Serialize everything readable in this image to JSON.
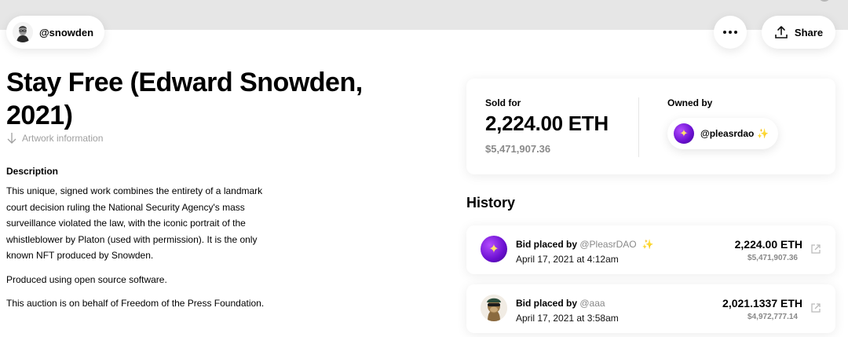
{
  "creator": {
    "handle": "@snowden",
    "avatar_icon": "snowden-portrait-icon"
  },
  "header": {
    "more_icon": "ellipsis-icon",
    "share_label": "Share",
    "share_icon": "upload-icon"
  },
  "artwork": {
    "title": "Stay Free (Edward Snowden, 2021)",
    "info_link": "Artwork information",
    "description_heading": "Description",
    "description": [
      "This unique, signed work combines the entirety of a landmark court decision ruling the National Security Agency's mass surveillance violated the law, with the iconic portrait of the whistleblower by Platon (used with permission). It is the only known NFT produced by Snowden.",
      "Produced using open source software.",
      "This auction is on behalf of Freedom of the Press Foundation."
    ]
  },
  "sale": {
    "sold_label": "Sold for",
    "eth": "2,224.00 ETH",
    "usd": "$5,471,907.36",
    "owned_label": "Owned by",
    "owner": "@pleasrdao",
    "owner_sparkle": "✨"
  },
  "history": {
    "title": "History",
    "items": [
      {
        "action": "Bid placed by",
        "user": "@PleasrDAO",
        "sparkle": "✨",
        "date": "April 17, 2021 at 4:12am",
        "eth": "2,224.00 ETH",
        "usd": "$5,471,907.36",
        "avatar_icon": "pleasrdao-avatar-icon"
      },
      {
        "action": "Bid placed by",
        "user": "@aaa",
        "sparkle": "",
        "date": "April 17, 2021 at 3:58am",
        "eth": "2,021.1337 ETH",
        "usd": "$4,972,777.14",
        "avatar_icon": "ape-avatar-icon"
      }
    ]
  },
  "colors": {
    "accent_purple": "#7a1fe0",
    "muted_text": "#888888",
    "band": "#e6e6e6"
  }
}
